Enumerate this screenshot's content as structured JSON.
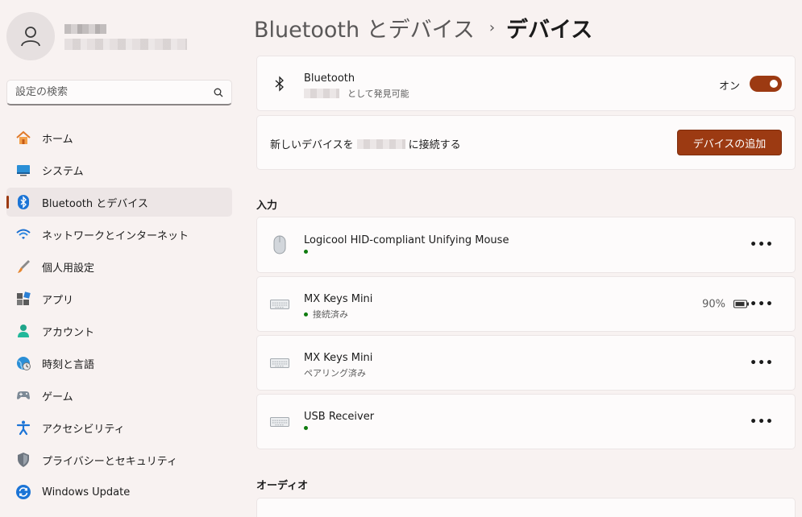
{
  "sidebar": {
    "search_placeholder": "設定の検索",
    "items": [
      {
        "label": "ホーム",
        "icon": "home-icon"
      },
      {
        "label": "システム",
        "icon": "system-icon"
      },
      {
        "label": "Bluetooth とデバイス",
        "icon": "bluetooth-icon",
        "active": true
      },
      {
        "label": "ネットワークとインターネット",
        "icon": "wifi-icon"
      },
      {
        "label": "個人用設定",
        "icon": "brush-icon"
      },
      {
        "label": "アプリ",
        "icon": "apps-icon"
      },
      {
        "label": "アカウント",
        "icon": "account-icon"
      },
      {
        "label": "時刻と言語",
        "icon": "time-language-icon"
      },
      {
        "label": "ゲーム",
        "icon": "gamepad-icon"
      },
      {
        "label": "アクセシビリティ",
        "icon": "accessibility-icon"
      },
      {
        "label": "プライバシーとセキュリティ",
        "icon": "shield-icon"
      },
      {
        "label": "Windows Update",
        "icon": "update-icon"
      }
    ]
  },
  "breadcrumb": {
    "parent": "Bluetooth とデバイス",
    "separator": "›",
    "current": "デバイス"
  },
  "bluetooth_card": {
    "title": "Bluetooth",
    "subtitle": "として発見可能",
    "toggle_label": "オン",
    "toggle_on": true
  },
  "connect_card": {
    "text_before": "新しいデバイスを",
    "text_after": "に接続する",
    "button": "デバイスの追加"
  },
  "input_section": {
    "title": "入力",
    "devices": [
      {
        "name": "Logicool HID-compliant Unifying Mouse",
        "status": "",
        "connected": true,
        "icon": "mouse-icon"
      },
      {
        "name": "MX Keys Mini",
        "status": "接続済み",
        "connected": true,
        "battery": "90%",
        "icon": "keyboard-icon"
      },
      {
        "name": "MX Keys Mini",
        "status": "ペアリング済み",
        "connected": false,
        "icon": "keyboard-icon"
      },
      {
        "name": "USB Receiver",
        "status": "",
        "connected": true,
        "icon": "keyboard-icon"
      }
    ]
  },
  "audio_section": {
    "title": "オーディオ"
  },
  "colors": {
    "accent": "#9c3a12",
    "connected_dot": "#0f7b0f",
    "background": "#f8f2f1",
    "card": "#fdfbfb"
  }
}
